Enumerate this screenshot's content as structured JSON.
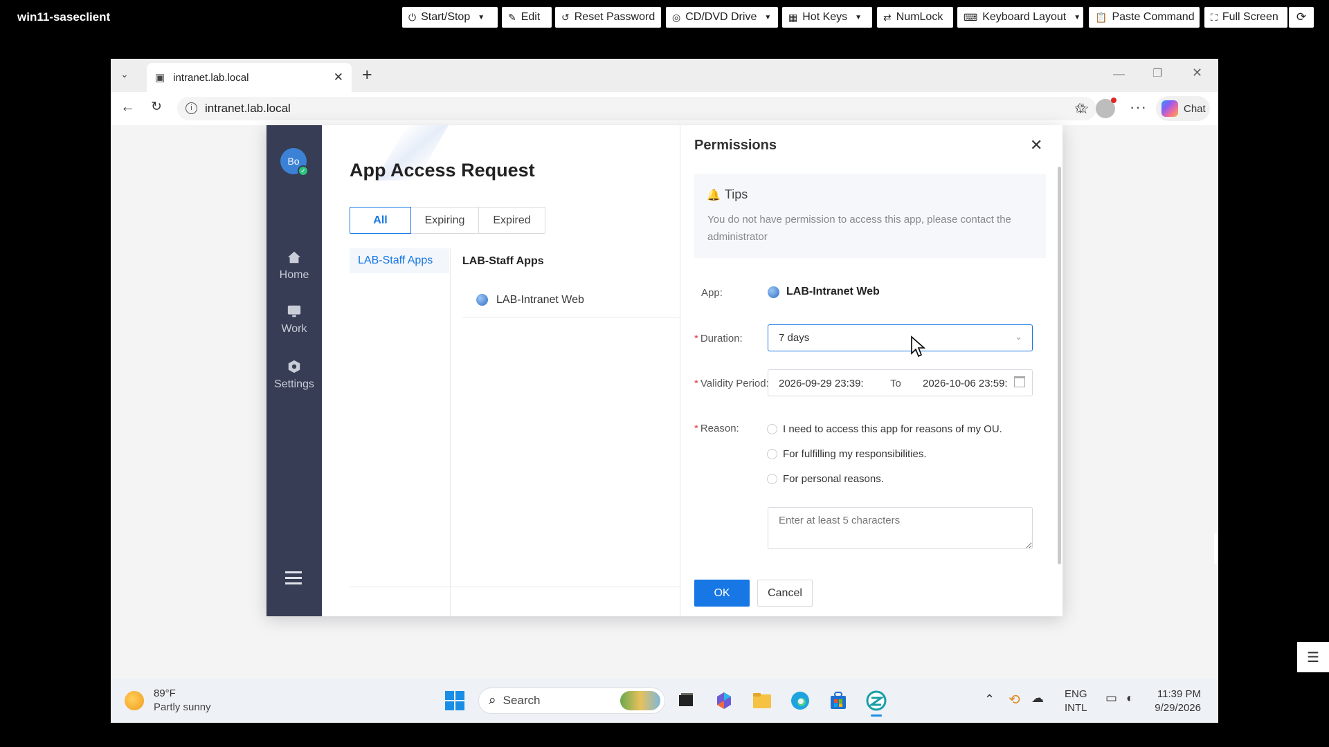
{
  "console": {
    "title": "win11-saseclient",
    "buttons": [
      {
        "label": "Start/Stop",
        "icon": "power-icon",
        "caret": true
      },
      {
        "label": "Edit",
        "icon": "pencil-icon",
        "caret": false
      },
      {
        "label": "Reset Password",
        "icon": "reset-icon",
        "caret": false
      },
      {
        "label": "CD/DVD Drive",
        "icon": "disc-icon",
        "caret": true
      },
      {
        "label": "Hot Keys",
        "icon": "grid-icon",
        "caret": true
      },
      {
        "label": "NumLock",
        "icon": "arrows-icon",
        "caret": false
      },
      {
        "label": "Keyboard Layout",
        "icon": "keyboard-icon",
        "caret": true
      },
      {
        "label": "Paste Command",
        "icon": "paste-icon",
        "caret": false
      },
      {
        "label": "Full Screen",
        "icon": "fullscreen-icon",
        "caret": false
      }
    ]
  },
  "browser": {
    "tab_title": "intranet.lab.local",
    "url": "intranet.lab.local",
    "chat_label": "Chat"
  },
  "sidebar": {
    "avatar_initials": "Bo",
    "items": [
      {
        "label": "Home",
        "icon": "home-icon"
      },
      {
        "label": "Work",
        "icon": "monitor-icon"
      },
      {
        "label": "Settings",
        "icon": "gear-icon"
      }
    ]
  },
  "main": {
    "title": "App Access Request",
    "filters": [
      "All",
      "Expiring",
      "Expired"
    ],
    "active_filter": "All",
    "group_nav": "LAB-Staff Apps",
    "group_header": "LAB-Staff Apps",
    "app_item": "LAB-Intranet Web"
  },
  "dialog": {
    "title": "Permissions",
    "tips_title": "Tips",
    "tips_text": "You do not have permission to access this app, please contact the administrator",
    "app_label": "App:",
    "app_value": "LAB-Intranet Web",
    "duration_label": "Duration:",
    "duration_value": "7 days",
    "validity_label": "Validity Period:",
    "validity_start": "2026-09-29 23:39:",
    "validity_to": "To",
    "validity_end": "2026-10-06 23:59:",
    "reason_label": "Reason:",
    "reasons": [
      "I need to access this app for reasons of my OU.",
      "For fulfilling my responsibilities.",
      "For personal reasons."
    ],
    "reason_placeholder": "Enter at least 5 characters",
    "ok_label": "OK",
    "cancel_label": "Cancel",
    "accent_color": "#1677e5"
  },
  "taskbar": {
    "weather_temp": "89°F",
    "weather_desc": "Partly sunny",
    "search_label": "Search",
    "lang_1": "ENG",
    "lang_2": "INTL",
    "time": "11:39 PM",
    "date": "9/29/2026"
  }
}
